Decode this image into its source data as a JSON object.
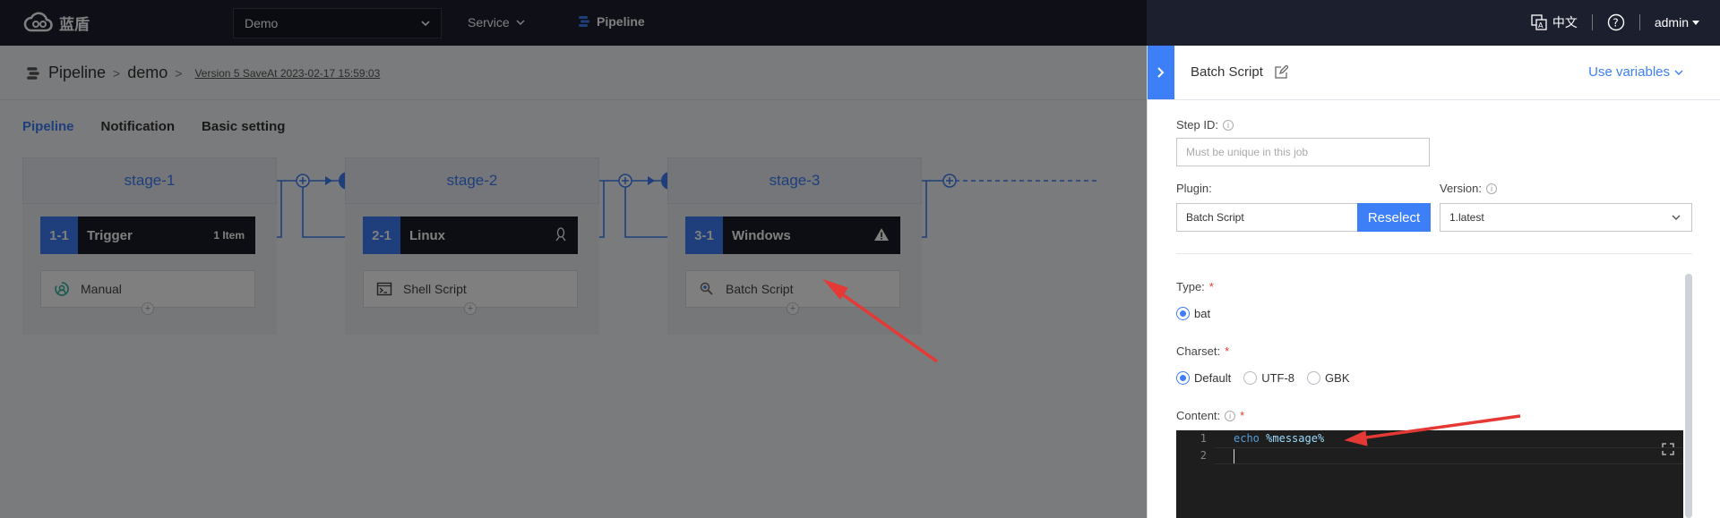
{
  "topbar": {
    "logo_text": "蓝盾",
    "project": "Demo",
    "service_label": "Service",
    "pipeline_label": "Pipeline",
    "lang_label": "中文",
    "help_icon": "question-icon",
    "user": "admin"
  },
  "breadcrumb": {
    "root": "Pipeline",
    "name": "demo",
    "version": "Version 5 SaveAt 2023-02-17 15:59:03"
  },
  "tabs": [
    {
      "label": "Pipeline",
      "active": true
    },
    {
      "label": "Notification",
      "active": false
    },
    {
      "label": "Basic setting",
      "active": false
    }
  ],
  "stages": [
    {
      "name": "stage-1",
      "job_num": "1-1",
      "job_name": "Trigger",
      "job_extra": "1 Item",
      "step": "Manual",
      "step_icon": "trigger-icon"
    },
    {
      "name": "stage-2",
      "job_num": "2-1",
      "job_name": "Linux",
      "job_extra_icon": "linux-icon",
      "step": "Shell Script",
      "step_icon": "terminal-icon"
    },
    {
      "name": "stage-3",
      "job_num": "3-1",
      "job_name": "Windows",
      "job_extra_icon": "warning-icon",
      "step": "Batch Script",
      "step_icon": "batch-script-icon"
    }
  ],
  "panel": {
    "title": "Batch Script",
    "use_variables": "Use variables",
    "step_id_label": "Step ID:",
    "step_id_placeholder": "Must be unique in this job",
    "plugin_label": "Plugin:",
    "plugin_value": "Batch Script",
    "reselect": "Reselect",
    "version_label": "Version:",
    "version_value": "1.latest",
    "type_label": "Type:",
    "type_options": [
      "bat"
    ],
    "type_selected": "bat",
    "charset_label": "Charset:",
    "charset_options": [
      "Default",
      "UTF-8",
      "GBK"
    ],
    "charset_selected": "Default",
    "content_label": "Content:",
    "code_lines": [
      "echo %message%",
      ""
    ],
    "code_keyword": "echo",
    "code_arg": "%message%"
  },
  "colors": {
    "accent": "#3c7ff6",
    "topbar_bg": "#1c1f2e",
    "job_head_bg": "#1b1d29",
    "annotation_arrow": "#e53935"
  }
}
